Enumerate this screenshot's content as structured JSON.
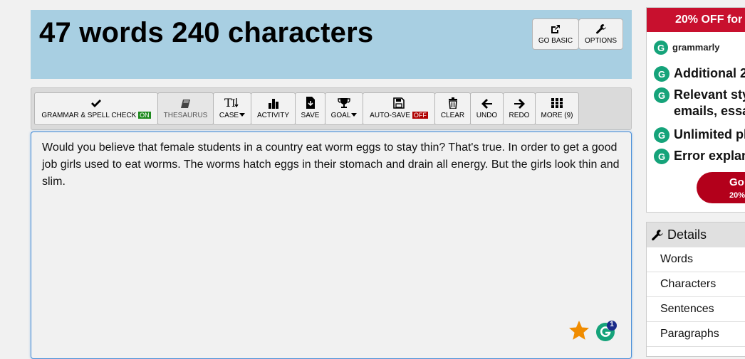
{
  "header": {
    "title": "47 words 240 characters",
    "go_basic_label": "GO BASIC",
    "options_label": "OPTIONS"
  },
  "toolbar": {
    "grammar_label": "GRAMMAR & SPELL CHECK",
    "grammar_state": "ON",
    "thesaurus_label": "THESAURUS",
    "case_label": "CASE",
    "activity_label": "ACTIVITY",
    "save_label": "SAVE",
    "goal_label": "GOAL",
    "autosave_label": "AUTO-SAVE",
    "autosave_state": "OFF",
    "clear_label": "CLEAR",
    "undo_label": "UNDO",
    "redo_label": "REDO",
    "more_label": "MORE (9)"
  },
  "editor": {
    "text": "Would you believe that female students in a country eat worm eggs to stay thin? That's true. In order to get a good job girls used to eat worms. The worms hatch eggs in their stomach and drain all energy. But the girls look thin and slim.",
    "grammarly_count": "1"
  },
  "ad": {
    "banner": "20% OFF for",
    "logo": "grammarly",
    "features": [
      "Additional 2",
      "Relevant sty",
      "emails, essa",
      "Unlimited pl",
      "Error explan"
    ],
    "cta_main": "Go",
    "cta_sub": "20%"
  },
  "details": {
    "title": "Details",
    "rows": [
      "Words",
      "Characters",
      "Sentences",
      "Paragraphs"
    ]
  },
  "colors": {
    "header_bg": "#a8cfe2",
    "on_badge": "#1f8a1f",
    "off_badge": "#b00000",
    "ad_red": "#c8102e",
    "grammarly_green": "#15a37a",
    "star": "#f08c00"
  }
}
